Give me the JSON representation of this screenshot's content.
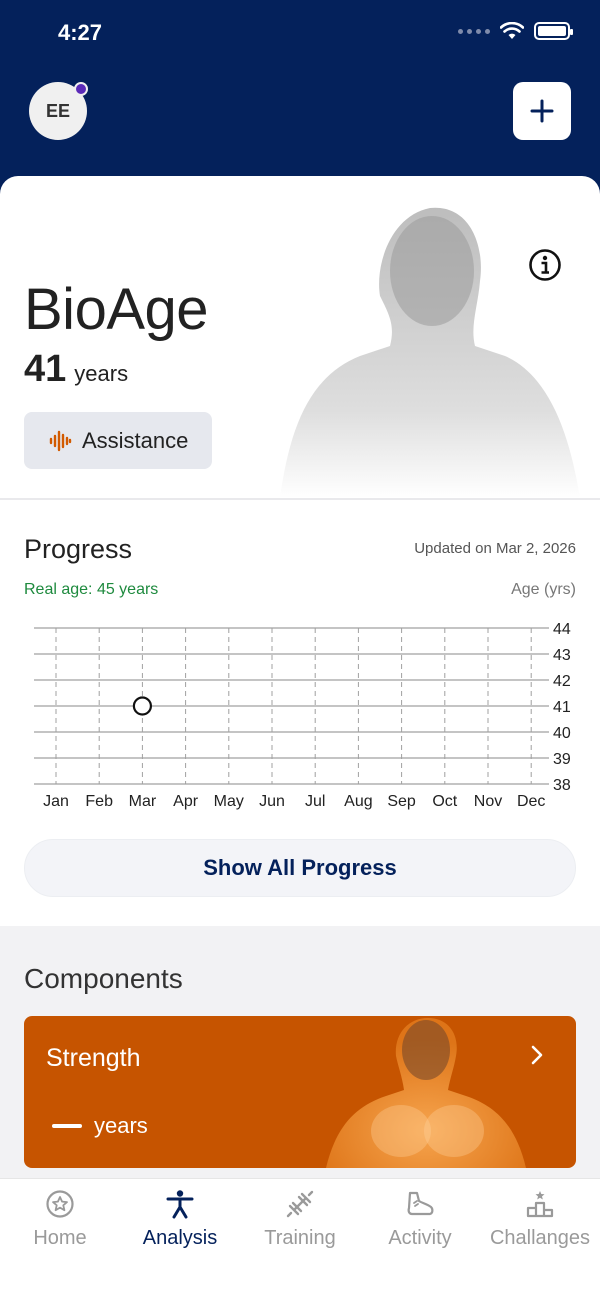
{
  "status_bar": {
    "time": "4:27"
  },
  "header": {
    "avatar_initials": "EE",
    "add_label": "+"
  },
  "bioage": {
    "title": "BioAge",
    "age_value": "41",
    "age_unit": "years",
    "assistance_label": "Assistance"
  },
  "progress": {
    "title": "Progress",
    "updated": "Updated on Mar 2, 2026",
    "real_age": "Real age: 45 years",
    "axis_label": "Age (yrs)",
    "show_all_label": "Show All Progress"
  },
  "chart_data": {
    "type": "scatter",
    "categories": [
      "Jan",
      "Feb",
      "Mar",
      "Apr",
      "May",
      "Jun",
      "Jul",
      "Aug",
      "Sep",
      "Oct",
      "Nov",
      "Dec"
    ],
    "ylim": [
      38,
      44
    ],
    "yticks": [
      "44",
      "43",
      "42",
      "41",
      "40",
      "39",
      "38"
    ],
    "ylabel": "Age (yrs)",
    "points": [
      {
        "x": "Mar",
        "y": 41
      }
    ],
    "grid": true
  },
  "components": {
    "title": "Components",
    "strength": {
      "label": "Strength",
      "value_unit": "years"
    }
  },
  "tabs": [
    {
      "label": "Home",
      "icon": "star-badge-icon",
      "active": false
    },
    {
      "label": "Analysis",
      "icon": "person-icon",
      "active": true
    },
    {
      "label": "Training",
      "icon": "dumbbell-icon",
      "active": false
    },
    {
      "label": "Activity",
      "icon": "shoe-icon",
      "active": false
    },
    {
      "label": "Challanges",
      "icon": "podium-icon",
      "active": false
    }
  ],
  "colors": {
    "navy": "#04215b",
    "orange": "#c65400",
    "green": "#1e8a3e"
  }
}
